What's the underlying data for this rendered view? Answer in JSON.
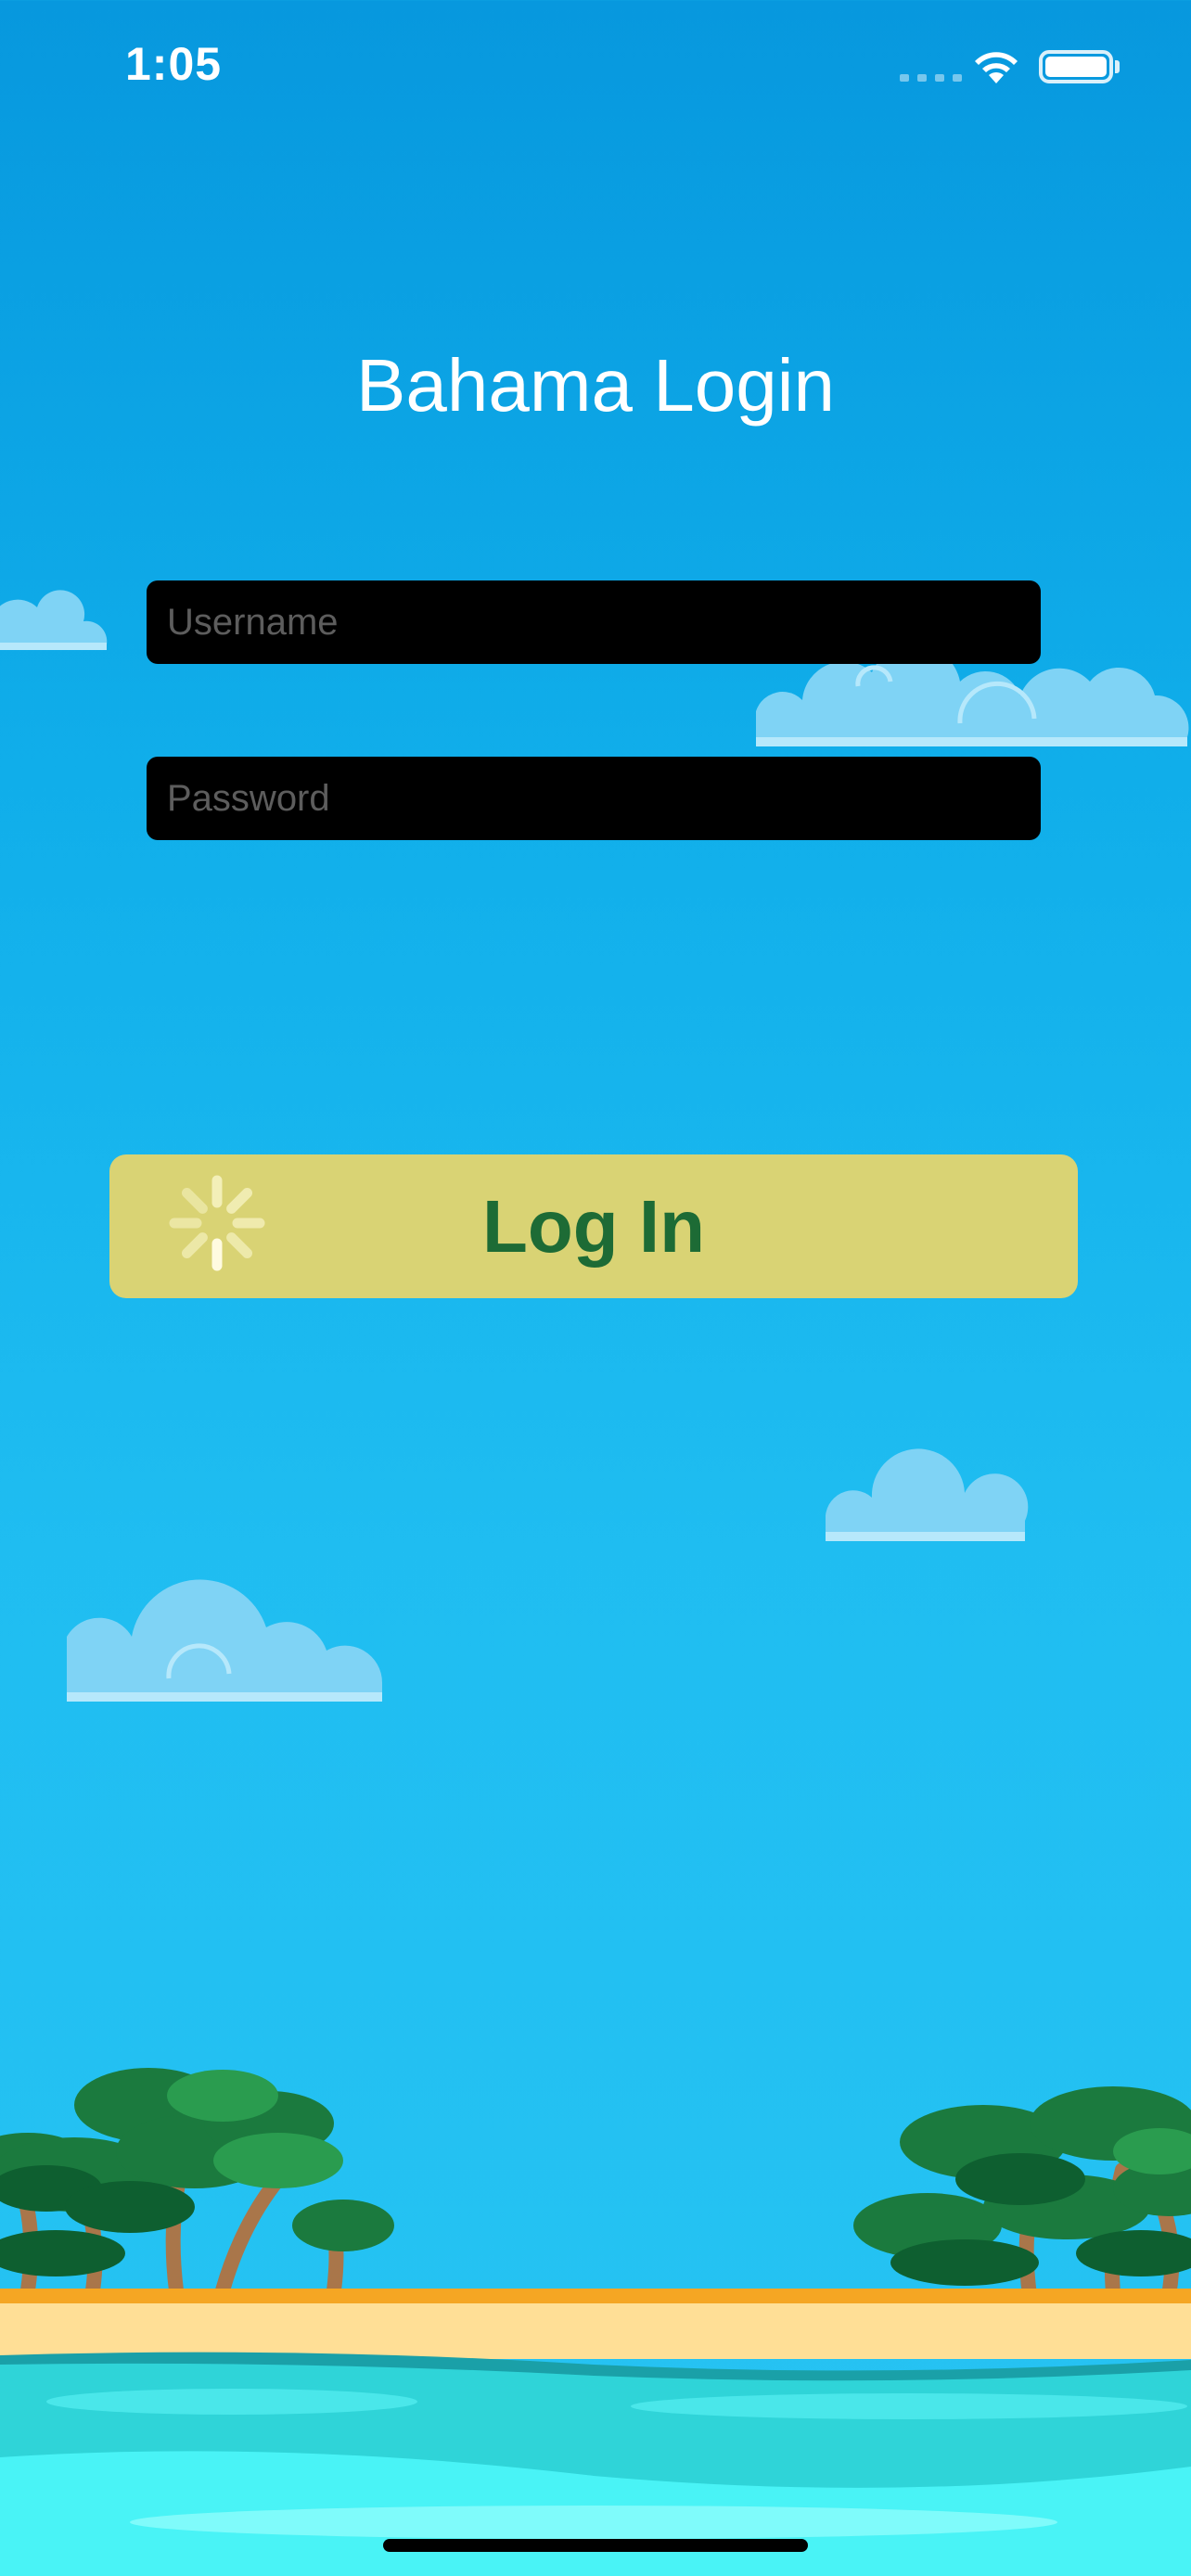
{
  "status_bar": {
    "time": "1:05",
    "wifi_icon": "wifi-icon",
    "battery_icon": "battery-icon"
  },
  "login": {
    "title": "Bahama Login",
    "username_placeholder": "Username",
    "username_value": "",
    "password_placeholder": "Password",
    "password_value": "",
    "login_label": "Log In",
    "loading_icon": "activity-spinner-icon"
  },
  "colors": {
    "sky_top": "#0798de",
    "sky_bottom": "#27c4f3",
    "button_bg": "#d9d374",
    "button_text": "#1d6b35",
    "field_bg": "#000000"
  }
}
